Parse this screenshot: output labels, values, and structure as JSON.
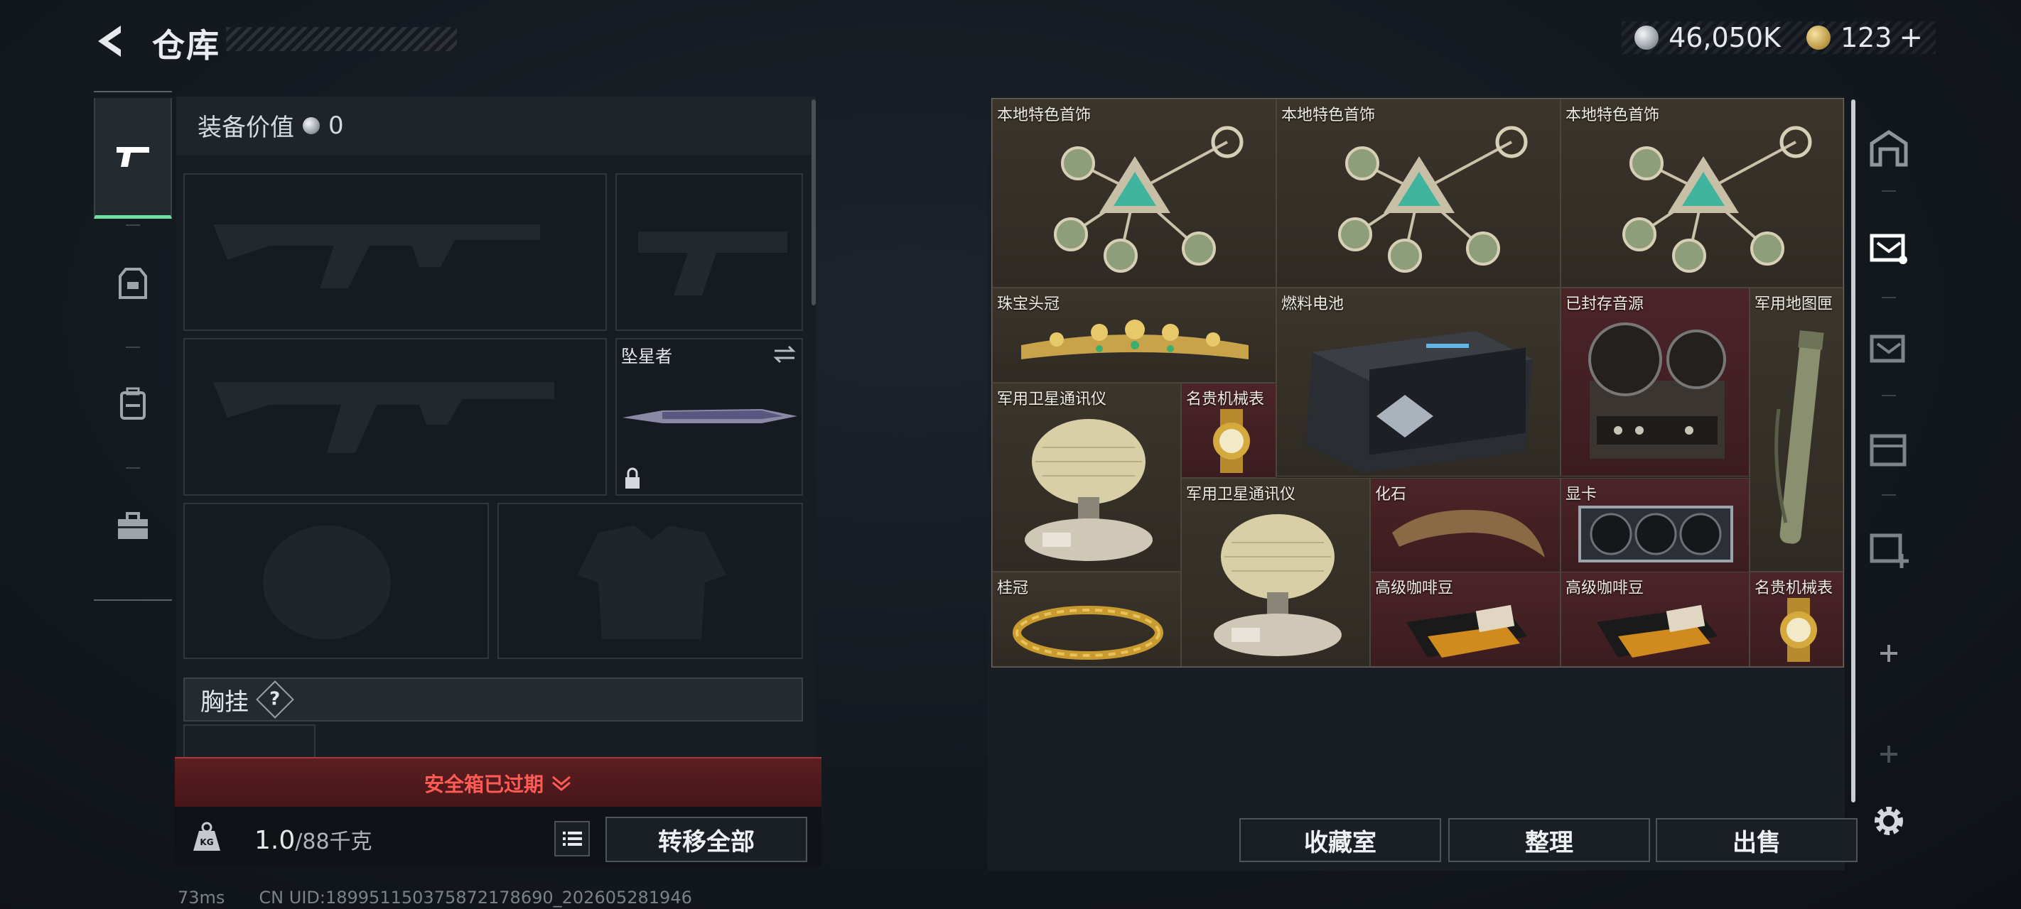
{
  "header": {
    "title": "仓库",
    "back_icon": "back-arrow-icon"
  },
  "currency": {
    "silver": "46,050K",
    "gold": "123",
    "plus": "+"
  },
  "equipment": {
    "value_label": "装备价值",
    "value": "0",
    "secondary_weapon_name": "坠星者",
    "chest_label": "胸挂",
    "help_mark": "?",
    "warning": "安全箱已过期",
    "weight_current": "1.0",
    "weight_max": "/88千克",
    "transfer_all": "转移全部"
  },
  "inventory": {
    "items": [
      {
        "name": "本地特色首饰"
      },
      {
        "name": "本地特色首饰"
      },
      {
        "name": "本地特色首饰"
      },
      {
        "name": "珠宝头冠"
      },
      {
        "name": "燃料电池"
      },
      {
        "name": "已封存音源"
      },
      {
        "name": "军用地图匣"
      },
      {
        "name": "军用卫星通讯仪"
      },
      {
        "name": "名贵机械表"
      },
      {
        "name": "军用卫星通讯仪"
      },
      {
        "name": "化石"
      },
      {
        "name": "显卡"
      },
      {
        "name": "桂冠"
      },
      {
        "name": "高级咖啡豆"
      },
      {
        "name": "高级咖啡豆"
      },
      {
        "name": "名贵机械表"
      }
    ],
    "buttons": {
      "collection": "收藏室",
      "sort": "整理",
      "sell": "出售"
    }
  },
  "status": {
    "ping": "73ms",
    "uid": "CN UID:18995115037587217869​0_202605281946"
  },
  "colors": {
    "accent_green": "#6ddf9f",
    "warning_red": "#ff5a54",
    "rare_red": "#4b2428"
  }
}
